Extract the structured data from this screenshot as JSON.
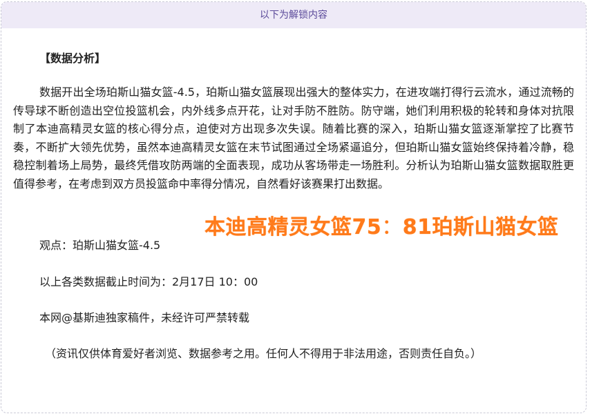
{
  "unlock_banner": "以下为解锁内容",
  "article": {
    "heading": "【数据分析】",
    "body": "数据开出全场珀斯山猫女篮-4.5，珀斯山猫女篮展现出强大的整体实力，在进攻端打得行云流水，通过流畅的传导球不断创造出空位投篮机会，内外线多点开花，让对手防不胜防。防守端，她们利用积极的轮转和身体对抗限制了本迪高精灵女篮的核心得分点，迫使对方出现多次失误。随着比赛的深入，珀斯山猫女篮逐渐掌控了比赛节奏，不断扩大领先优势，虽然本迪高精灵女篮在末节试图通过全场紧逼追分，但珀斯山猫女篮始终保持着冷静，稳稳控制着场上局势，最终凭借攻防两端的全面表现，成功从客场带走一场胜利。分析认为珀斯山猫女篮数据取胜更值得参考，在考虑到双方员投篮命中率得分情况，自然看好该赛果打出数据。",
    "viewpoint": "观点：珀斯山猫女篮-4.5",
    "cutoff_time": "以上各类数据截止时间为：2月17日 10：00",
    "copyright": "本网@基斯迪独家稿件，未经许可严禁转载",
    "disclaimer": "（资讯仅供体育爱好者浏览、数据参考之用。任何人不得用于非法用途，否则责任自负。）"
  },
  "score_overlay": {
    "home_team": "本迪高精灵女篮",
    "home_score": "75",
    "separator": "：",
    "away_score": "81",
    "away_team": "珀斯山猫女篮"
  },
  "colors": {
    "banner_bg": "#eeeaf7",
    "banner_text": "#5b4a9a",
    "overlay_orange": "#ff7a1a",
    "border": "#c9c9d6"
  }
}
